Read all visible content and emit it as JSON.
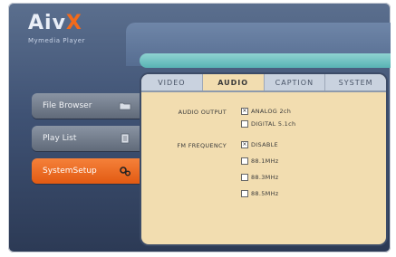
{
  "app": {
    "logo_prefix": "Aiv",
    "logo_x": "X",
    "subtitle": "Mymedia Player"
  },
  "sidebar": {
    "items": [
      {
        "label": "File Browser"
      },
      {
        "label": "Play List"
      },
      {
        "label": "SystemSetup"
      }
    ]
  },
  "tabs": [
    "VIDEO",
    "AUDIO",
    "CAPTION",
    "SYSTEM"
  ],
  "audio": {
    "output_label": "AUDIO OUTPUT",
    "output_options": [
      "ANALOG 2ch",
      "DIGITAL 5.1ch"
    ],
    "fm_label": "FM FREQUENCY",
    "fm_options": [
      "DISABLE",
      "88.1MHz",
      "88.3MHz",
      "88.5MHz"
    ]
  },
  "colors": {
    "accent": "#e25a12",
    "panel": "#f2ddb0"
  }
}
